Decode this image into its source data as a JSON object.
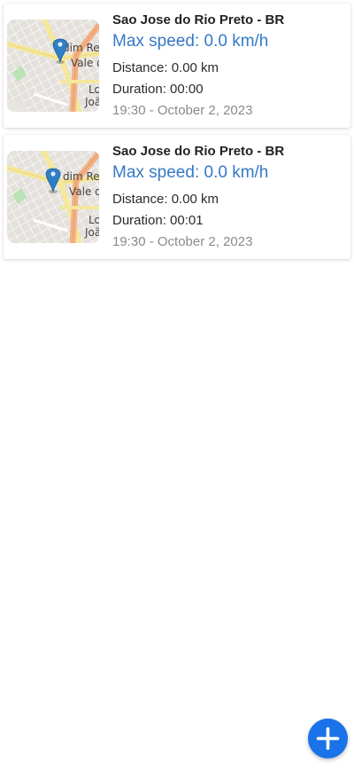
{
  "trips": [
    {
      "city": "Sao Jose do Rio Preto - BR",
      "max_speed": "Max speed: 0.0 km/h",
      "distance": "Distance: 0.00 km",
      "duration": "Duration: 00:00",
      "timestamp": "19:30 - October 2, 2023",
      "map_labels": [
        "dim Re",
        "Vale d",
        "Lo",
        "Joã"
      ]
    },
    {
      "city": "Sao Jose do Rio Preto - BR",
      "max_speed": "Max speed: 0.0 km/h",
      "distance": "Distance: 0.00 km",
      "duration": "Duration: 00:01",
      "timestamp": "19:30 - October 2, 2023",
      "map_labels": [
        "dim Re",
        "Vale d",
        "Lo",
        "Joã"
      ]
    }
  ],
  "fab": {
    "icon": "plus-icon",
    "color": "#1a73e8"
  },
  "colors": {
    "speed_text": "#3579c5",
    "map_pin": "#2f7fc5",
    "map_road_major": "#f4b183",
    "map_road_minor": "#f5e79b",
    "map_park": "#b9e3b5"
  }
}
